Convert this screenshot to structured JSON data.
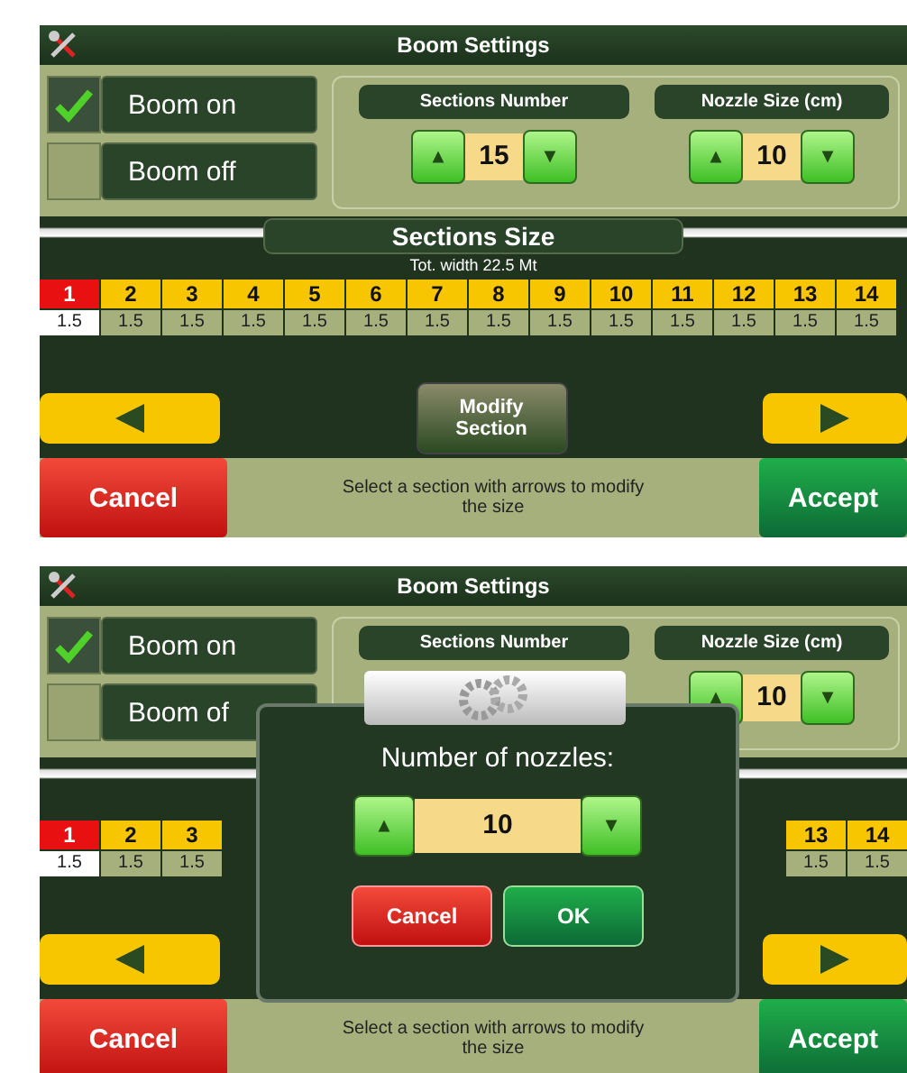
{
  "screens": [
    {
      "title": "Boom Settings",
      "boom_options": [
        {
          "label": "Boom on",
          "checked": true
        },
        {
          "label": "Boom off",
          "checked": false
        }
      ],
      "spinners": [
        {
          "label": "Sections Number",
          "value": "15",
          "loading": false
        },
        {
          "label": "Nozzle Size (cm)",
          "value": "10",
          "loading": false
        }
      ],
      "sections_title": "Sections Size",
      "total_width": "Tot. width 22.5 Mt",
      "section_groups": [
        [
          {
            "number": "1",
            "size": "1.5",
            "selected": true
          },
          {
            "number": "2",
            "size": "1.5",
            "selected": false
          },
          {
            "number": "3",
            "size": "1.5",
            "selected": false
          },
          {
            "number": "4",
            "size": "1.5",
            "selected": false
          },
          {
            "number": "5",
            "size": "1.5",
            "selected": false
          },
          {
            "number": "6",
            "size": "1.5",
            "selected": false
          },
          {
            "number": "7",
            "size": "1.5",
            "selected": false
          },
          {
            "number": "8",
            "size": "1.5",
            "selected": false
          },
          {
            "number": "9",
            "size": "1.5",
            "selected": false
          },
          {
            "number": "10",
            "size": "1.5",
            "selected": false
          },
          {
            "number": "11",
            "size": "1.5",
            "selected": false
          },
          {
            "number": "12",
            "size": "1.5",
            "selected": false
          },
          {
            "number": "13",
            "size": "1.5",
            "selected": false
          },
          {
            "number": "14",
            "size": "1.5",
            "selected": false
          }
        ]
      ],
      "modify_button": "Modify Section",
      "hint": "Select a section with arrows to modify the size",
      "cancel": "Cancel",
      "accept": "Accept"
    },
    {
      "title": "Boom Settings",
      "boom_options": [
        {
          "label": "Boom on",
          "checked": true
        },
        {
          "label": "Boom of",
          "checked": false
        }
      ],
      "spinners": [
        {
          "label": "Sections Number",
          "loading": true
        },
        {
          "label": "Nozzle Size (cm)",
          "value": "10",
          "loading": false
        }
      ],
      "section_groups": [
        [
          {
            "number": "1",
            "size": "1.5",
            "selected": true
          },
          {
            "number": "2",
            "size": "1.5",
            "selected": false
          },
          {
            "number": "3",
            "size": "1.5",
            "selected": false
          }
        ],
        [
          {
            "number": "13",
            "size": "1.5",
            "selected": false
          },
          {
            "number": "14",
            "size": "1.5",
            "selected": false
          }
        ]
      ],
      "dialog": {
        "title": "Number of nozzles:",
        "value": "10",
        "cancel": "Cancel",
        "ok": "OK"
      },
      "hint": "Select a section with arrows to modify the size",
      "cancel": "Cancel",
      "accept": "Accept"
    }
  ]
}
